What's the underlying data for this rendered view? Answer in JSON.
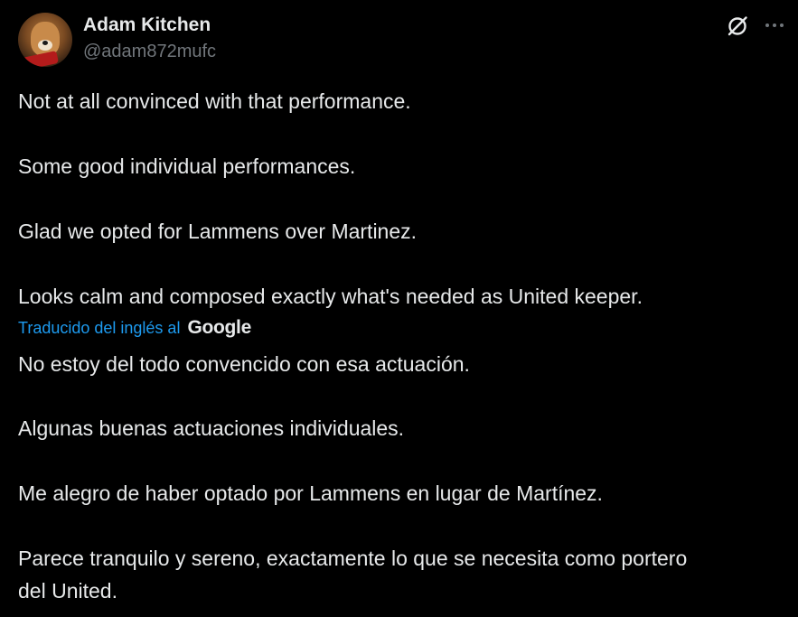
{
  "author": {
    "display_name": "Adam Kitchen",
    "handle": "@adam872mufc",
    "avatar_icon": "dog-avatar"
  },
  "header_icons": {
    "grok": "grok-icon",
    "more": "more-icon"
  },
  "original_text": [
    "Not at all convinced with that performance.",
    "Some good individual performances.",
    "Glad we opted for Lammens over Martinez.",
    "Looks calm and composed exactly what's needed as United keeper."
  ],
  "translation": {
    "label": "Traducido del inglés al",
    "provider": "Google"
  },
  "translated_text": [
    "No estoy del todo convencido con esa actuación.",
    "Algunas buenas actuaciones individuales.",
    "Me alegro de haber optado por Lammens en lugar de Martínez.",
    "Parece tranquilo y sereno, exactamente lo que se necesita como portero",
    "del United."
  ],
  "colors": {
    "background": "#000000",
    "text_primary": "#e7e9ea",
    "text_secondary": "#71767b",
    "link": "#1d9bf0"
  }
}
